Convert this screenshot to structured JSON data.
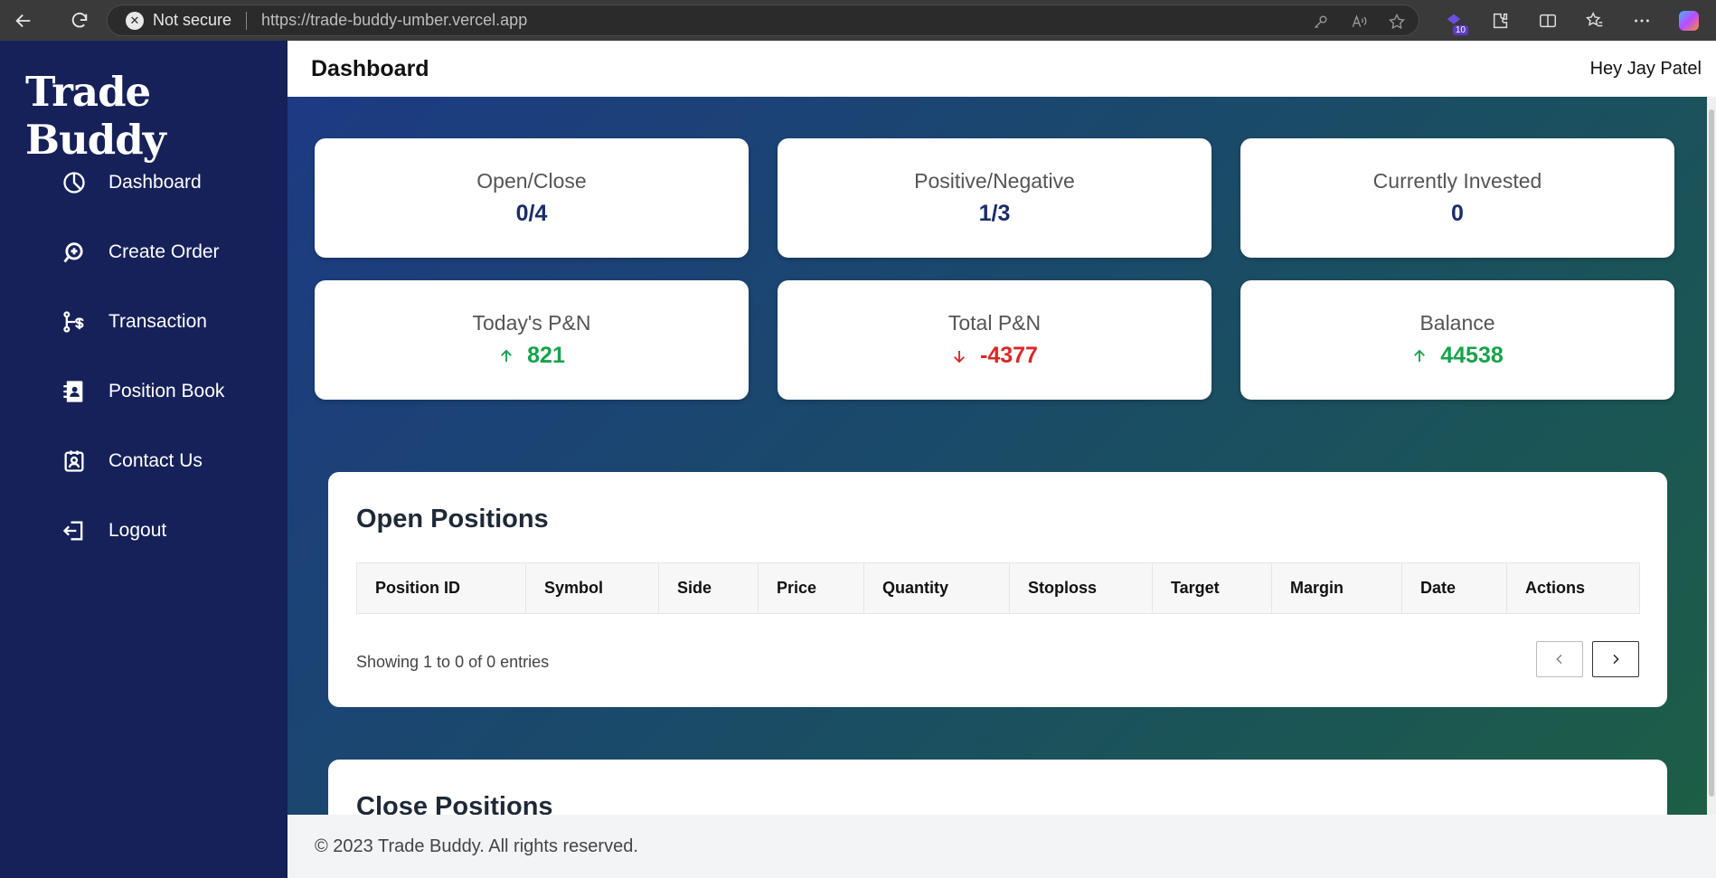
{
  "browser": {
    "security_label": "Not secure",
    "url": "https://trade-buddy-umber.vercel.app",
    "extension_badge": "10"
  },
  "app": {
    "brand": "Trade Buddy",
    "page_title": "Dashboard",
    "greeting": "Hey Jay Patel"
  },
  "sidebar": {
    "items": [
      {
        "label": "Dashboard",
        "icon": "pie-chart-icon"
      },
      {
        "label": "Create Order",
        "icon": "order-icon"
      },
      {
        "label": "Transaction",
        "icon": "transaction-icon"
      },
      {
        "label": "Position Book",
        "icon": "contact-book-icon"
      },
      {
        "label": "Contact Us",
        "icon": "contact-badge-icon"
      },
      {
        "label": "Logout",
        "icon": "logout-icon"
      }
    ]
  },
  "stats": [
    {
      "label": "Open/Close",
      "value": "0/4"
    },
    {
      "label": "Positive/Negative",
      "value": "1/3"
    },
    {
      "label": "Currently Invested",
      "value": "0"
    },
    {
      "label": "Today's P&N",
      "value": "821",
      "trend": "up"
    },
    {
      "label": "Total P&N",
      "value": "-4377",
      "trend": "down"
    },
    {
      "label": "Balance",
      "value": "44538",
      "trend": "up"
    }
  ],
  "colors": {
    "sidebar": "#162159",
    "positive": "#16a34a",
    "negative": "#dc2626",
    "neutral_value": "#1a2d6b"
  },
  "open_positions": {
    "title": "Open Positions",
    "columns": [
      "Position ID",
      "Symbol",
      "Side",
      "Price",
      "Quantity",
      "Stoploss",
      "Target",
      "Margin",
      "Date",
      "Actions"
    ],
    "rows": [],
    "entries_text": "Showing 1 to 0 of 0 entries"
  },
  "close_positions": {
    "title": "Close Positions"
  },
  "footer": {
    "text": "© 2023 Trade Buddy. All rights reserved."
  }
}
